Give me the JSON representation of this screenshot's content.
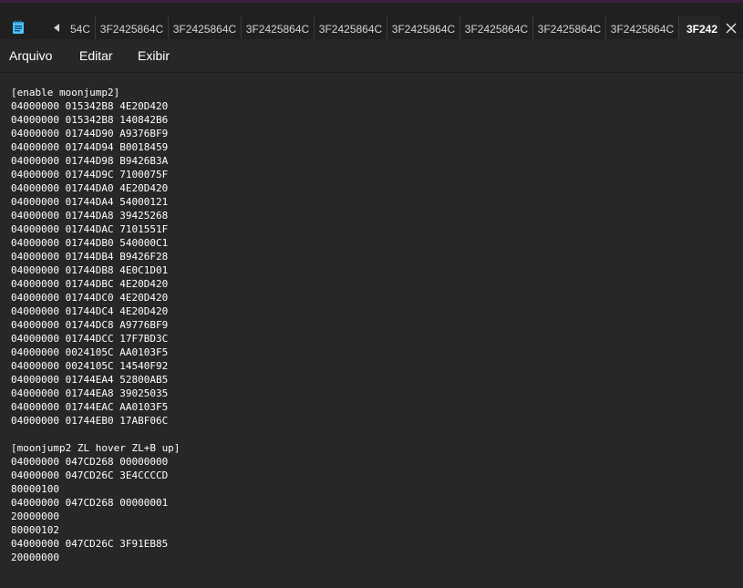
{
  "tabs": {
    "items": [
      "54C",
      "3F2425864C",
      "3F2425864C",
      "3F2425864C",
      "3F2425864C",
      "3F2425864C",
      "3F2425864C",
      "3F2425864C",
      "3F2425864C"
    ],
    "active": "3F242"
  },
  "menu": {
    "arquivo": "Arquivo",
    "editar": "Editar",
    "exibir": "Exibir"
  },
  "editor": {
    "lines": [
      "[enable moonjump2]",
      "04000000 015342B8 4E20D420",
      "04000000 015342B8 140842B6",
      "04000000 01744D90 A9376BF9",
      "04000000 01744D94 B0018459",
      "04000000 01744D98 B9426B3A",
      "04000000 01744D9C 7100075F",
      "04000000 01744DA0 4E20D420",
      "04000000 01744DA4 54000121",
      "04000000 01744DA8 39425268",
      "04000000 01744DAC 7101551F",
      "04000000 01744DB0 540000C1",
      "04000000 01744DB4 B9426F28",
      "04000000 01744DB8 4E0C1D01",
      "04000000 01744DBC 4E20D420",
      "04000000 01744DC0 4E20D420",
      "04000000 01744DC4 4E20D420",
      "04000000 01744DC8 A9776BF9",
      "04000000 01744DCC 17F7BD3C",
      "04000000 0024105C AA0103F5",
      "04000000 0024105C 14540F92",
      "04000000 01744EA4 52800AB5",
      "04000000 01744EA8 39025035",
      "04000000 01744EAC AA0103F5",
      "04000000 01744EB0 17ABF06C",
      "",
      "[moonjump2 ZL hover ZL+B up]",
      "04000000 047CD268 00000000",
      "04000000 047CD26C 3E4CCCCD",
      "80000100",
      "04000000 047CD268 00000001",
      "20000000",
      "80000102",
      "04000000 047CD26C 3F91EB85",
      "20000000"
    ]
  },
  "colors": {
    "background": "#272727",
    "titlebar": "#202020",
    "text": "#ffffff"
  }
}
